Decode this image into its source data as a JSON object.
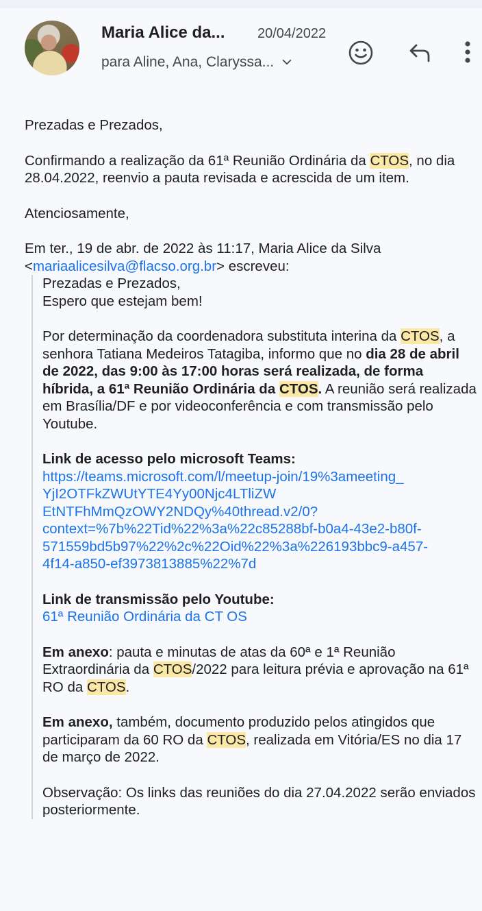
{
  "header": {
    "sender": "Maria Alice da...",
    "date": "20/04/2022",
    "recipients": "para Aline, Ana, Claryssa..."
  },
  "icons": {
    "emoji": "emoji-smile-icon",
    "reply": "reply-icon",
    "more": "more-vert-icon",
    "chevron": "chevron-down-icon"
  },
  "email": {
    "greeting": "Prezadas e Prezados,",
    "confirm_1": "Confirmando a realização da 61ª Reunião Ordinária da ",
    "ctos": "CTOS",
    "confirm_2": ", no dia 28.04.2022, reenvio a pauta revisada e acrescida de um item.",
    "signoff": "Atenciosamente,",
    "quote_intro_1": "Em ter., 19 de abr. de 2022 às 11:17, Maria Alice da Silva",
    "quote_email_pre": "<",
    "quote_email": "mariaalicesilva@flacso.org.br",
    "quote_email_post": "> escreveu:",
    "quote": {
      "greeting": "Prezadas e Prezados,",
      "hope": "Espero que estejam bem!",
      "para1_a": "Por determinação da coordenadora substituta interina da ",
      "para1_b": ", a senhora Tatiana Medeiros Tatagiba, informo que no ",
      "para1_bold": "dia 28 de abril de 2022, das 9:00 às 17:00 horas será realizada, de forma híbrida, a 61ª Reunião Ordinária da ",
      "para1_bold_end": ".",
      "para1_c": " A reunião será realizada em Brasília/DF e por videoconferência e com transmissão pelo Youtube.",
      "teams_label": "Link de acesso pelo microsoft Teams:",
      "teams_link_lines": [
        "https://teams.microsoft.com/l/meetup-join/19%3ameeting_",
        "YjI2OTFkZWUtYTE4Yy00Njc4LTliZW",
        "EtNTFhMmQzOWY2NDQy%40thread.v2/0?",
        "context=%7b%22Tid%22%3a%22c85288bf-b0a4-43e2-b80f-",
        "571559bd5b97%22%2c%22Oid%22%3a%226193bbc9-a457-",
        "4f14-a850-ef3973813885%22%7d"
      ],
      "youtube_label": "Link de transmissão pelo Youtube:",
      "youtube_link": "61ª Reunião Ordinária da CT OS",
      "annex1_bold": "Em anexo",
      "annex1_a": ": pauta e minutas de atas da 60ª e 1ª Reunião Extraordinária da ",
      "annex1_b": "/2022 para leitura prévia e aprovação na 61ª RO da ",
      "annex1_c": ".",
      "annex2_bold": "Em anexo,",
      "annex2_a": " também, documento produzido pelos atingidos que participaram da 60 RO da ",
      "annex2_b": ", realizada em Vitória/ES no dia 17 de março de 2022.",
      "obs": "Observação: Os links das reuniões do dia 27.04.2022 serão enviados posteriormente."
    }
  }
}
